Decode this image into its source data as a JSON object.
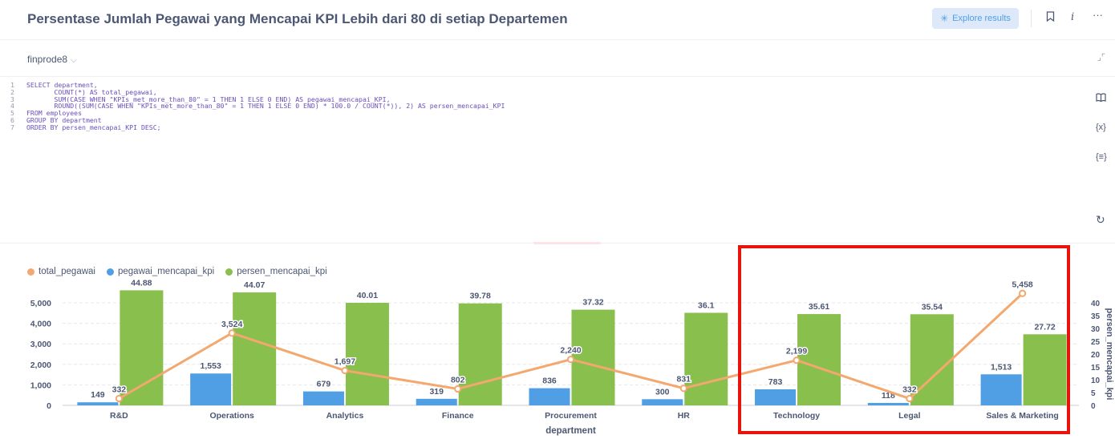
{
  "question": {
    "title": "Persentase Jumlah Pegawai yang Mencapai KPI Lebih dari 80 di setiap Departemen",
    "explore_label": "Explore results",
    "bookmark_icon": "bookmark-icon",
    "info_icon": "info-icon",
    "more_icon": "more-icon"
  },
  "editor": {
    "database": "finprode8",
    "sql_lines": [
      {
        "n": "1",
        "text": "SELECT department,"
      },
      {
        "n": "2",
        "text": "       COUNT(*) AS total_pegawai,"
      },
      {
        "n": "3",
        "text": "       SUM(CASE WHEN \"KPIs_met_more_than_80\" = 1 THEN 1 ELSE 0 END) AS pegawai_mencapai_KPI,"
      },
      {
        "n": "4",
        "text": "       ROUND((SUM(CASE WHEN \"KPIs_met_more_than_80\" = 1 THEN 1 ELSE 0 END) * 100.0 / COUNT(*)), 2) AS persen_mencapai_KPI"
      },
      {
        "n": "5",
        "text": "FROM employees"
      },
      {
        "n": "6",
        "text": "GROUP BY department"
      },
      {
        "n": "7",
        "text": "ORDER BY persen_mencapai_KPI DESC;"
      }
    ],
    "side_icons": [
      "book-icon",
      "variable-icon",
      "snippet-icon"
    ],
    "side_glyphs": [
      "🕮",
      "{x}",
      "{≡}"
    ],
    "refresh_icon": "refresh-icon"
  },
  "chart_data": {
    "type": "bar",
    "categories": [
      "R&D",
      "Operations",
      "Analytics",
      "Finance",
      "Procurement",
      "HR",
      "Technology",
      "Legal",
      "Sales & Marketing"
    ],
    "xlabel": "department",
    "ylabel_right": "persen_mencapai_kpi",
    "ylim_left": [
      0,
      5000
    ],
    "ylim_right": [
      0,
      40
    ],
    "y_ticks_left": [
      "0",
      "1,000",
      "2,000",
      "3,000",
      "4,000",
      "5,000"
    ],
    "y_ticks_right": [
      "0",
      "5",
      "10",
      "15",
      "20",
      "25",
      "30",
      "35",
      "40"
    ],
    "series": [
      {
        "name": "total_pegawai",
        "kind": "line",
        "axis": "left",
        "color": "#f2a86f",
        "values": [
          332,
          3524,
          1697,
          802,
          2240,
          831,
          2199,
          332,
          5458
        ],
        "labels": [
          "332",
          "3,524",
          "1,697",
          "802",
          "2,240",
          "831",
          "2,199",
          "332",
          "5,458"
        ]
      },
      {
        "name": "pegawai_mencapai_kpi",
        "kind": "bar",
        "axis": "left",
        "color": "#509ee3",
        "values": [
          149,
          1553,
          679,
          319,
          836,
          300,
          783,
          118,
          1513
        ],
        "labels": [
          "149",
          "1,553",
          "679",
          "319",
          "836",
          "300",
          "783",
          "118",
          "1,513"
        ]
      },
      {
        "name": "persen_mencapai_kpi",
        "kind": "bar",
        "axis": "right",
        "color": "#88bf4d",
        "values": [
          44.88,
          44.07,
          40.01,
          39.78,
          37.32,
          36.1,
          35.61,
          35.54,
          27.72
        ],
        "labels": [
          "44.88",
          "44.07",
          "40.01",
          "39.78",
          "37.32",
          "36.1",
          "35.61",
          "35.54",
          "27.72"
        ]
      }
    ],
    "legend_position": "top-left",
    "grid": true
  },
  "annotation": {
    "color": "#e8130d",
    "highlight": "Technology, Legal, Sales & Marketing"
  }
}
